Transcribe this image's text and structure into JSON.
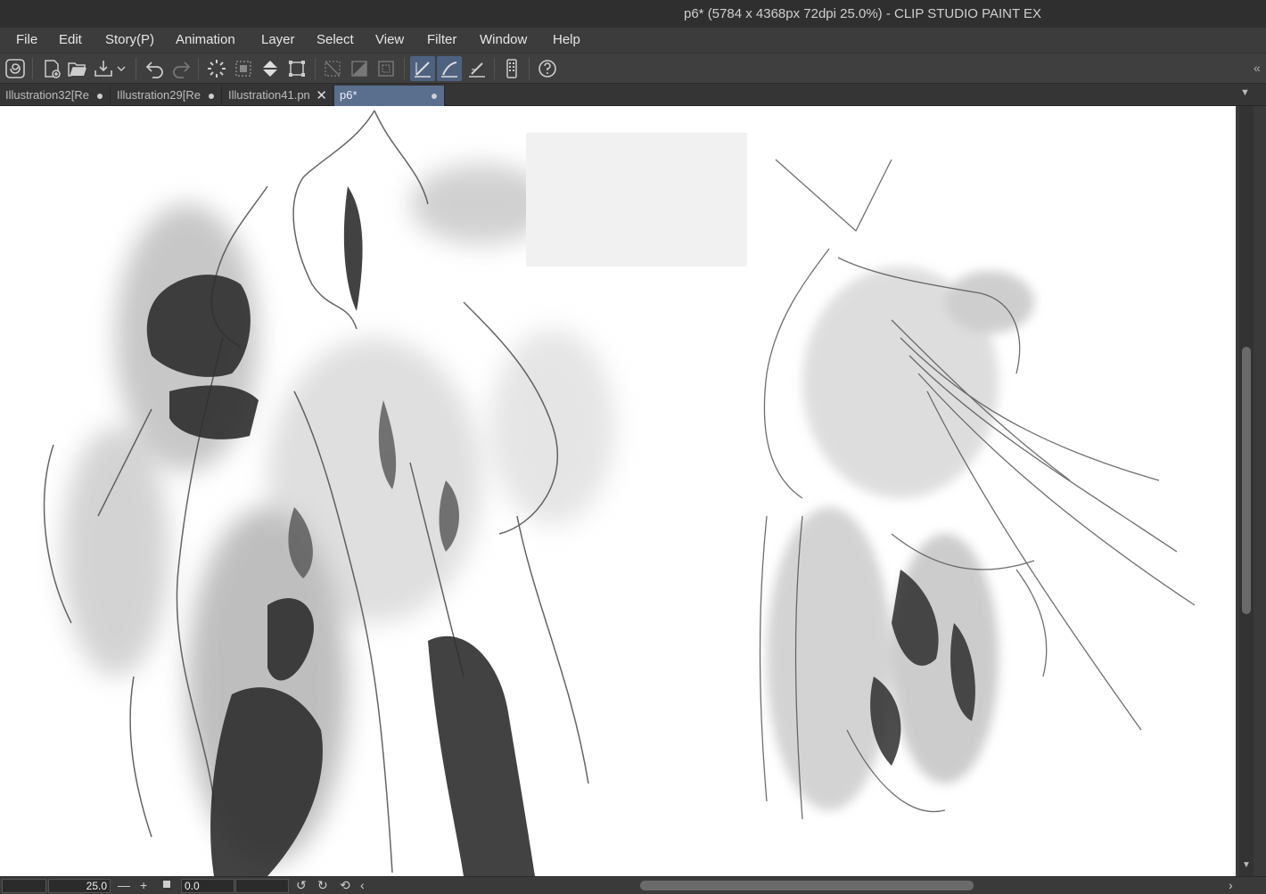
{
  "window": {
    "title": "p6* (5784 x 4368px 72dpi 25.0%)  - CLIP STUDIO PAINT EX"
  },
  "menu": [
    "File",
    "Edit",
    "Story(P)",
    "Animation",
    "Layer",
    "Select",
    "View",
    "Filter",
    "Window",
    "Help"
  ],
  "toolbar": {
    "icons": [
      "clip-studio-logo-icon",
      "new-canvas-icon",
      "open-folder-icon",
      "save-icon",
      "dropdown-icon",
      "undo-icon",
      "redo-icon",
      "loading-spinner-icon",
      "select-all-icon",
      "fill-icon",
      "transform-icon",
      "hide-selection-icon",
      "invert-selection-icon",
      "selection-border-icon",
      "snap-to-ruler-icon",
      "snap-to-special-ruler-icon",
      "snap-to-grid-icon",
      "smartphone-icon",
      "help-icon"
    ]
  },
  "tabs": [
    {
      "label": "Illustration32[Re",
      "modified": true
    },
    {
      "label": "Illustration29[Re",
      "modified": true
    },
    {
      "label": "Illustration41.pn",
      "close": "✕"
    },
    {
      "label": "p6*",
      "modified": true,
      "active": true
    }
  ],
  "status": {
    "zoom": "25.0",
    "minus": "—",
    "plus": "+",
    "angle": "0.0"
  },
  "colors": {
    "active_tab": "#5a6e8e",
    "active_tool": "#4e6280"
  }
}
